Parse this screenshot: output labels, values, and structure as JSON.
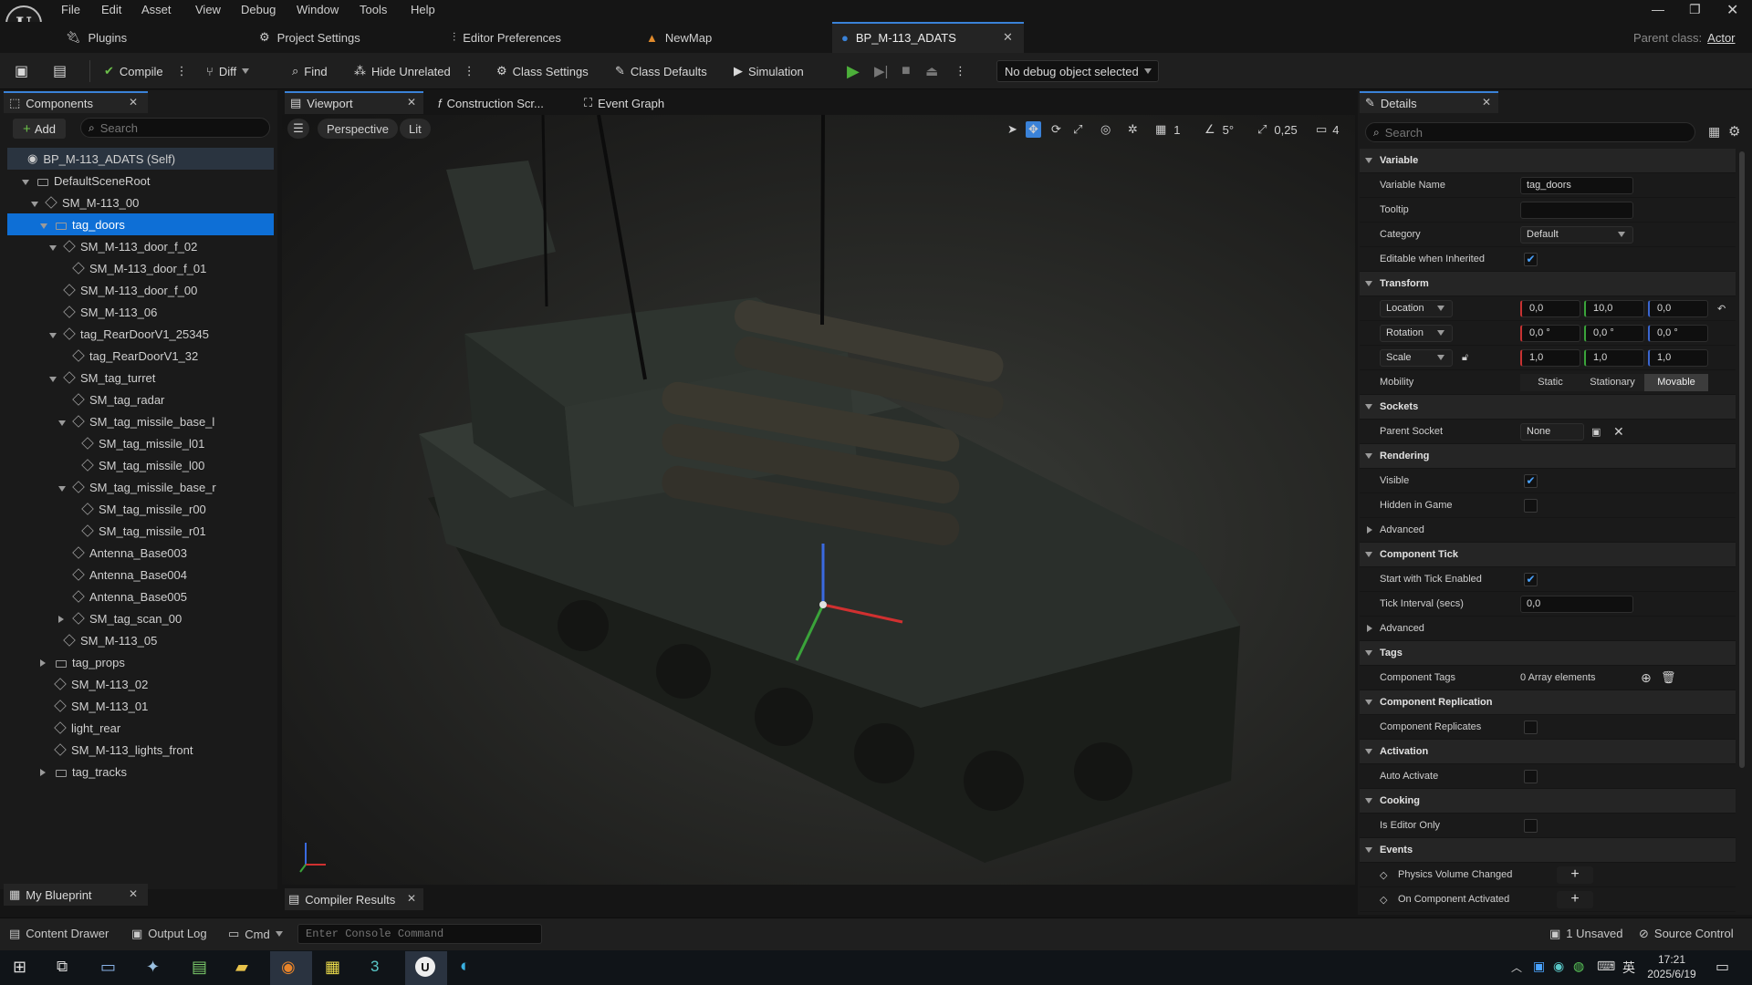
{
  "menu": [
    "File",
    "Edit",
    "Asset",
    "View",
    "Debug",
    "Window",
    "Tools",
    "Help"
  ],
  "tabs": {
    "plugins": "Plugins",
    "project_settings": "Project Settings",
    "editor_prefs": "Editor Preferences",
    "newmap": "NewMap",
    "bp": "BP_M-113_ADATS"
  },
  "parent_class": {
    "label": "Parent class:",
    "value": "Actor"
  },
  "toolbar": {
    "compile": "Compile",
    "diff": "Diff",
    "find": "Find",
    "hide_unrelated": "Hide Unrelated",
    "class_settings": "Class Settings",
    "class_defaults": "Class Defaults",
    "simulation": "Simulation",
    "debug_object": "No debug object selected"
  },
  "components": {
    "title": "Components",
    "add": "Add",
    "search_placeholder": "Search",
    "tree": [
      {
        "label": "BP_M-113_ADATS (Self)",
        "indent": 0,
        "icon": "self",
        "arrow": "none"
      },
      {
        "label": "DefaultSceneRoot",
        "indent": 1,
        "icon": "scene",
        "arrow": "down"
      },
      {
        "label": "SM_M-113_00",
        "indent": 2,
        "icon": "mesh",
        "arrow": "down"
      },
      {
        "label": "tag_doors",
        "indent": 3,
        "icon": "scene",
        "arrow": "down",
        "selected": true
      },
      {
        "label": "SM_M-113_door_f_02",
        "indent": 4,
        "icon": "mesh",
        "arrow": "down"
      },
      {
        "label": "SM_M-113_door_f_01",
        "indent": 5,
        "icon": "mesh",
        "arrow": "none"
      },
      {
        "label": "SM_M-113_door_f_00",
        "indent": 4,
        "icon": "mesh",
        "arrow": "none"
      },
      {
        "label": "SM_M-113_06",
        "indent": 4,
        "icon": "mesh",
        "arrow": "none"
      },
      {
        "label": "tag_RearDoorV1_25345",
        "indent": 4,
        "icon": "mesh",
        "arrow": "down"
      },
      {
        "label": "tag_RearDoorV1_32",
        "indent": 5,
        "icon": "mesh",
        "arrow": "none"
      },
      {
        "label": "SM_tag_turret",
        "indent": 4,
        "icon": "mesh",
        "arrow": "down"
      },
      {
        "label": "SM_tag_radar",
        "indent": 5,
        "icon": "mesh",
        "arrow": "none"
      },
      {
        "label": "SM_tag_missile_base_l",
        "indent": 5,
        "icon": "mesh",
        "arrow": "down"
      },
      {
        "label": "SM_tag_missile_l01",
        "indent": 6,
        "icon": "mesh",
        "arrow": "none"
      },
      {
        "label": "SM_tag_missile_l00",
        "indent": 6,
        "icon": "mesh",
        "arrow": "none"
      },
      {
        "label": "SM_tag_missile_base_r",
        "indent": 5,
        "icon": "mesh",
        "arrow": "down"
      },
      {
        "label": "SM_tag_missile_r00",
        "indent": 6,
        "icon": "mesh",
        "arrow": "none"
      },
      {
        "label": "SM_tag_missile_r01",
        "indent": 6,
        "icon": "mesh",
        "arrow": "none"
      },
      {
        "label": "Antenna_Base003",
        "indent": 5,
        "icon": "mesh",
        "arrow": "none"
      },
      {
        "label": "Antenna_Base004",
        "indent": 5,
        "icon": "mesh",
        "arrow": "none"
      },
      {
        "label": "Antenna_Base005",
        "indent": 5,
        "icon": "mesh",
        "arrow": "none"
      },
      {
        "label": "SM_tag_scan_00",
        "indent": 5,
        "icon": "mesh",
        "arrow": "right"
      },
      {
        "label": "SM_M-113_05",
        "indent": 4,
        "icon": "mesh",
        "arrow": "none"
      },
      {
        "label": "tag_props",
        "indent": 3,
        "icon": "scene",
        "arrow": "right"
      },
      {
        "label": "SM_M-113_02",
        "indent": 3,
        "icon": "mesh",
        "arrow": "none"
      },
      {
        "label": "SM_M-113_01",
        "indent": 3,
        "icon": "mesh",
        "arrow": "none"
      },
      {
        "label": "light_rear",
        "indent": 3,
        "icon": "mesh",
        "arrow": "none"
      },
      {
        "label": "SM_M-113_lights_front",
        "indent": 3,
        "icon": "mesh",
        "arrow": "none"
      },
      {
        "label": "tag_tracks",
        "indent": 3,
        "icon": "scene",
        "arrow": "right"
      }
    ]
  },
  "my_blueprint": "My Blueprint",
  "editor_tabs": {
    "viewport": "Viewport",
    "construction": "Construction Scr...",
    "event_graph": "Event Graph"
  },
  "viewport": {
    "perspective": "Perspective",
    "lit": "Lit",
    "grid": "1",
    "angle": "5°",
    "scale": "0,25",
    "camera": "4"
  },
  "compiler_results": "Compiler Results",
  "details": {
    "title": "Details",
    "search_placeholder": "Search",
    "variable": {
      "section": "Variable",
      "name_label": "Variable Name",
      "name_value": "tag_doors",
      "tooltip_label": "Tooltip",
      "category_label": "Category",
      "category_value": "Default",
      "editable_label": "Editable when Inherited"
    },
    "transform": {
      "section": "Transform",
      "location": "Location",
      "rotation": "Rotation",
      "scale": "Scale",
      "loc": [
        "0,0",
        "10,0",
        "0,0"
      ],
      "rot": [
        "0,0 °",
        "0,0 °",
        "0,0 °"
      ],
      "scl": [
        "1,0",
        "1,0",
        "1,0"
      ],
      "mobility": "Mobility",
      "static": "Static",
      "stationary": "Stationary",
      "movable": "Movable"
    },
    "sockets": {
      "section": "Sockets",
      "parent_label": "Parent Socket",
      "parent_value": "None"
    },
    "rendering": {
      "section": "Rendering",
      "visible": "Visible",
      "hidden": "Hidden in Game",
      "advanced": "Advanced"
    },
    "tick": {
      "section": "Component Tick",
      "start": "Start with Tick Enabled",
      "interval": "Tick Interval (secs)",
      "interval_value": "0,0",
      "advanced": "Advanced"
    },
    "tags": {
      "section": "Tags",
      "label": "Component Tags",
      "value": "0 Array elements"
    },
    "replication": {
      "section": "Component Replication",
      "label": "Component Replicates"
    },
    "activation": {
      "section": "Activation",
      "label": "Auto Activate"
    },
    "cooking": {
      "section": "Cooking",
      "label": "Is Editor Only"
    },
    "events": {
      "section": "Events",
      "physics": "Physics Volume Changed",
      "activated": "On Component Activated"
    }
  },
  "status": {
    "content_drawer": "Content Drawer",
    "output_log": "Output Log",
    "cmd": "Cmd",
    "console_placeholder": "Enter Console Command",
    "unsaved": "1 Unsaved",
    "source_control": "Source Control"
  },
  "taskbar": {
    "time": "17:21",
    "date": "2025/6/19",
    "ime": "英"
  }
}
